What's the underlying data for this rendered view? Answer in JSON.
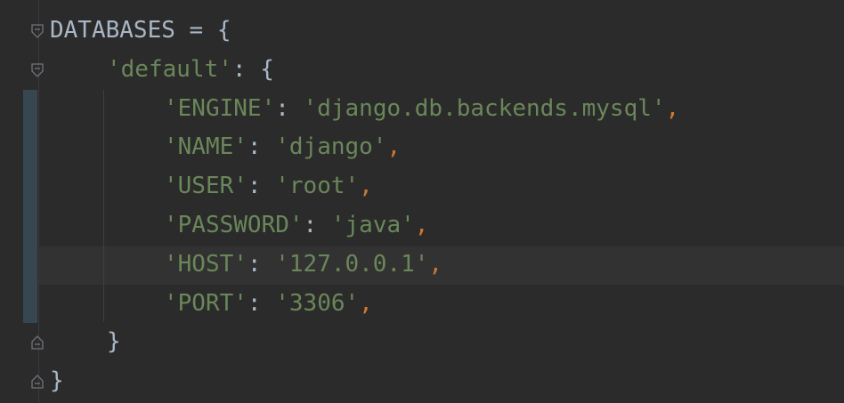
{
  "editor": {
    "theme_colors": {
      "background": "#2b2b2b",
      "identifier": "#a9b7c6",
      "string": "#6a8759",
      "comma": "#cc7832",
      "current_line": "#323232",
      "change_marker": "#374752"
    },
    "lines": [
      {
        "ident": "DATABASES",
        "op": " = ",
        "brace": "{"
      },
      {
        "key": "'default'",
        "colon": ": ",
        "brace": "{"
      },
      {
        "key": "'ENGINE'",
        "colon": ": ",
        "value": "'django.db.backends.mysql'",
        "comma": ","
      },
      {
        "key": "'NAME'",
        "colon": ": ",
        "value": "'django'",
        "comma": ","
      },
      {
        "key": "'USER'",
        "colon": ": ",
        "value": "'root'",
        "comma": ","
      },
      {
        "key": "'PASSWORD'",
        "colon": ": ",
        "value": "'java'",
        "comma": ","
      },
      {
        "key": "'HOST'",
        "colon": ": ",
        "value": "'127.0.0.1'",
        "comma": ","
      },
      {
        "key": "'PORT'",
        "colon": ": ",
        "value": "'3306'",
        "comma": ","
      },
      {
        "brace": "}"
      },
      {
        "brace": "}"
      }
    ],
    "fold_icons": [
      "fold-open-icon",
      "fold-open-icon",
      "fold-close-icon",
      "fold-close-icon"
    ]
  }
}
